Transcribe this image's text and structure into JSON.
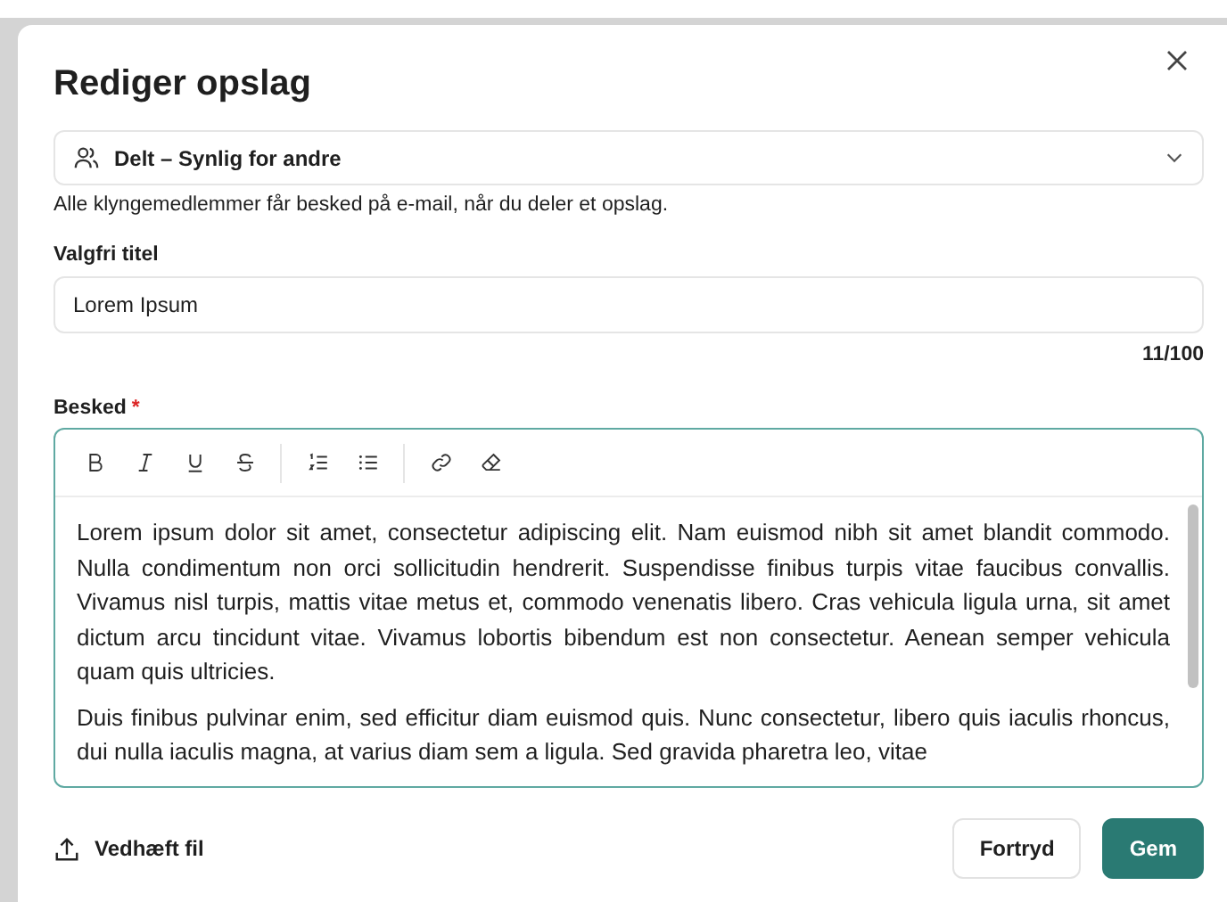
{
  "dialog": {
    "title": "Rediger opslag"
  },
  "visibility": {
    "label": "Delt – Synlig for andre",
    "helper": "Alle klyngemedlemmer får besked på e-mail, når du deler et opslag."
  },
  "title_field": {
    "label": "Valgfri titel",
    "value": "Lorem Ipsum",
    "counter": "11/100"
  },
  "message": {
    "label": "Besked",
    "required_mark": "*",
    "toolbar": [
      [
        {
          "kind": "bold"
        },
        {
          "kind": "italic"
        },
        {
          "kind": "underline"
        },
        {
          "kind": "strike"
        }
      ],
      [
        {
          "kind": "ordered-list"
        },
        {
          "kind": "bullet-list"
        }
      ],
      [
        {
          "kind": "link"
        },
        {
          "kind": "clear-format"
        }
      ]
    ],
    "paragraphs": [
      "Lorem ipsum dolor sit amet, consectetur adipiscing elit. Nam euismod nibh sit amet blandit commodo. Nulla condimentum non orci sollicitudin hendrerit. Suspendisse finibus turpis vitae faucibus convallis. Vivamus nisl turpis, mattis vitae metus et, commodo venenatis libero. Cras vehicula ligula urna, sit amet dictum arcu tincidunt vitae. Vivamus lobortis bibendum est non consectetur. Aenean semper vehicula quam quis ultricies.",
      "Duis finibus pulvinar enim, sed efficitur diam euismod quis. Nunc consectetur, libero quis iaculis rhoncus, dui nulla iaculis magna, at varius diam sem a ligula. Sed gravida pharetra leo, vitae"
    ]
  },
  "attach": {
    "label": "Vedhæft fil"
  },
  "buttons": [
    {
      "label": "Fortryd",
      "kind": "secondary"
    },
    {
      "label": "Gem",
      "kind": "primary"
    }
  ]
}
